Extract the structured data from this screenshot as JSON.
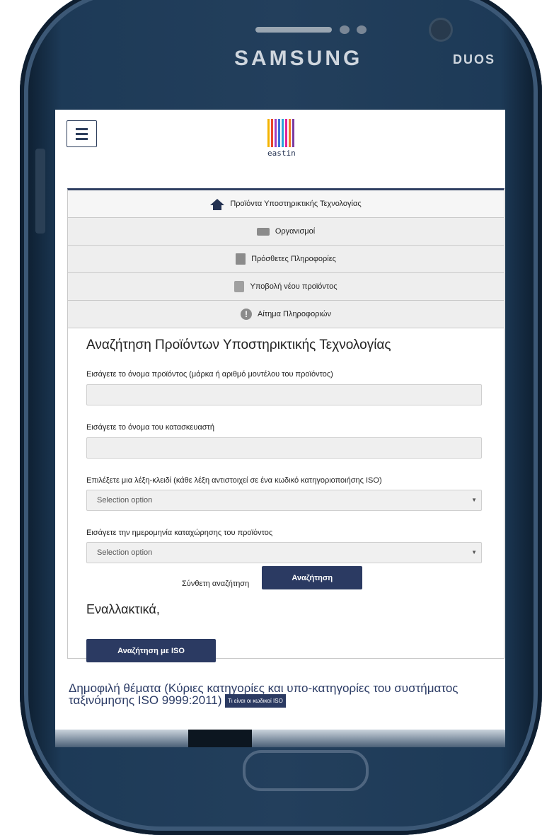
{
  "device": {
    "brand": "SAMSUNG",
    "model_badge": "DUOS"
  },
  "header": {
    "logo_text": "eastin",
    "logo_colors": [
      "#f4b400",
      "#e8452c",
      "#a23fbf",
      "#3b6fd9",
      "#29a3d9",
      "#e0219a",
      "#f47b20",
      "#7c3aa0"
    ]
  },
  "nav": {
    "items": [
      {
        "label": "Προϊόντα Υποστηρικτικής Τεχνολογίας",
        "icon": "home-icon"
      },
      {
        "label": "Οργανισμοί",
        "icon": "briefcase-icon"
      },
      {
        "label": "Πρόσθετες Πληροφορίες",
        "icon": "book-icon"
      },
      {
        "label": "Υποβολή νέου προϊόντος",
        "icon": "upload-icon"
      },
      {
        "label": "Αίτημα Πληροφοριών",
        "icon": "info-icon"
      }
    ]
  },
  "search": {
    "title": "Αναζήτηση Προϊόντων Υποστηρικτικής Τεχνολογίας",
    "product_label": "Εισάγετε το όνομα προϊόντος (μάρκα ή αριθμό μοντέλου του προϊόντος)",
    "manufacturer_label": "Εισάγετε το όνομα του κατασκευαστή",
    "keyword_label": "Επιλέξετε μια λέξη-κλειδί (κάθε λέξη αντιστοιχεί σε ένα κωδικό κατηγοριοποιήσης ISO)",
    "keyword_value": "Selection option",
    "date_label": "Εισάγετε την ημερομηνία καταχώρησης του προϊόντος",
    "date_value": "Selection option",
    "advanced_link": "Σύνθετη αναζήτηση",
    "search_button": "Αναζήτηση",
    "alternative_text": "Εναλλακτικά,",
    "iso_button": "Αναζήτηση με ISO"
  },
  "popular": {
    "text": "Δημοφιλή θέματα (Κύριες κατηγορίες και υπο-κατηγορίες του συστήματος ταξινόμησης ISO 9999:2011)",
    "badge": "Τι είναι οι κωδικοί ISO"
  }
}
